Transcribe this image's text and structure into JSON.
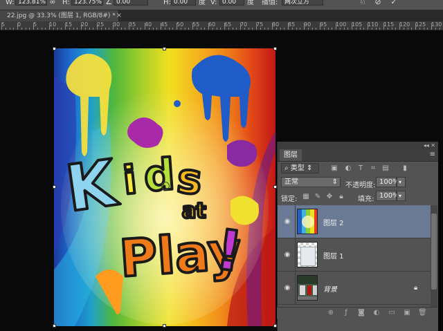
{
  "options_bar": {
    "w_label": "W:",
    "w_value": "123.81%",
    "link_icon": "link-icon",
    "h_label": "H:",
    "h_value": "123.75%",
    "angle_icon": "angle-icon",
    "angle_value": "0.00",
    "h_skew_label": "H:",
    "h_skew_value": "0.00",
    "h_skew_unit": "度",
    "v_skew_label": "V:",
    "v_skew_value": "0.00",
    "v_skew_unit": "度",
    "interp_label": "插值:",
    "interp_value": "两次立方",
    "warp_icon": "warp-icon",
    "cancel_icon": "cancel-icon",
    "commit_icon": "commit-icon"
  },
  "document_tab": {
    "title": "22.jpg @ 33.3% (图层 1, RGB/8#) *",
    "close": "×"
  },
  "ruler": {
    "labels": [
      "5",
      "0",
      "5",
      "10",
      "15",
      "20",
      "25",
      "30",
      "35",
      "40",
      "45",
      "50",
      "55",
      "60",
      "65",
      "70",
      "75",
      "80",
      "85",
      "90",
      "95",
      "100",
      "105",
      "110",
      "115",
      "120",
      "125",
      "130"
    ]
  },
  "artwork": {
    "logo_text": [
      "K",
      "i",
      "d",
      "s",
      "at",
      "Play",
      "!"
    ]
  },
  "layers_panel": {
    "tab_label": "图层",
    "filter_label": "类型",
    "blend_mode": "正常",
    "opacity_label": "不透明度:",
    "opacity_value": "100%",
    "lock_label": "锁定:",
    "fill_label": "填充:",
    "fill_value": "100%",
    "layers": [
      {
        "name": "图层 2",
        "selected": true
      },
      {
        "name": "图层 1",
        "selected": false
      },
      {
        "name": "背景",
        "selected": false,
        "locked": true
      }
    ]
  }
}
